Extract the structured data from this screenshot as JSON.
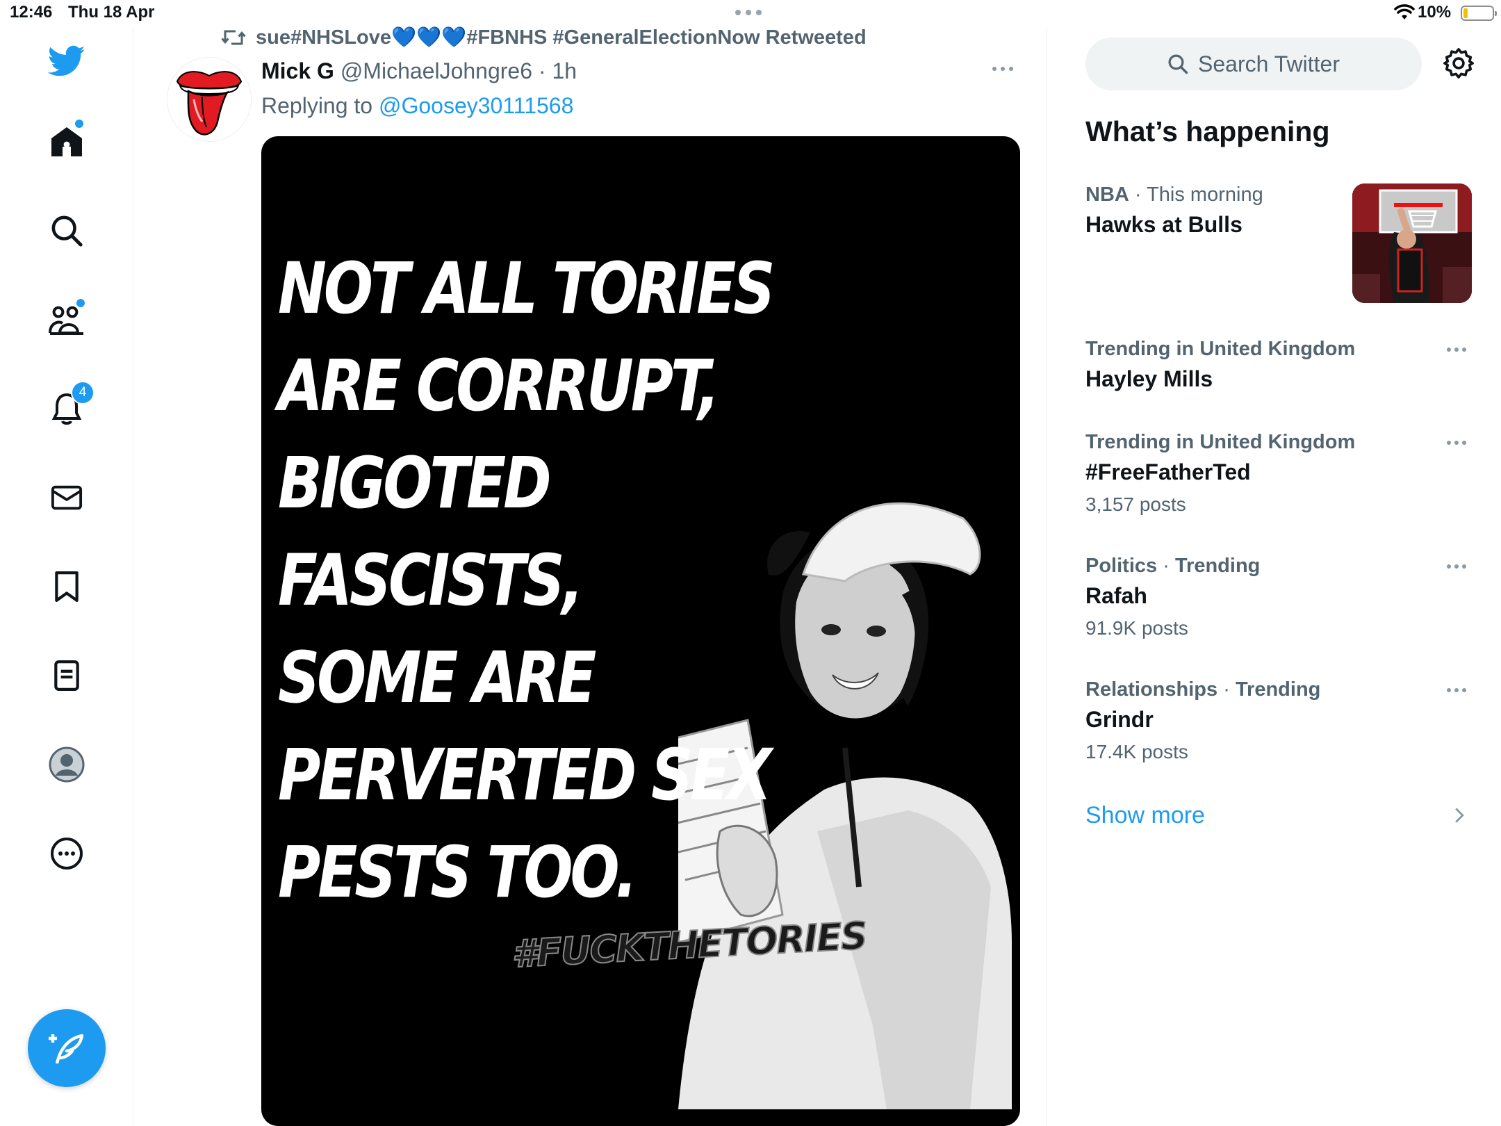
{
  "status_bar": {
    "time": "12:46",
    "date": "Thu 18 Apr",
    "battery": "10%"
  },
  "nav": {
    "items": [
      {
        "name": "home",
        "has_dot": true
      },
      {
        "name": "explore"
      },
      {
        "name": "communities",
        "has_dot": true
      },
      {
        "name": "notifications",
        "badge": "4"
      },
      {
        "name": "messages"
      },
      {
        "name": "bookmarks"
      },
      {
        "name": "lists"
      },
      {
        "name": "profile"
      },
      {
        "name": "more"
      }
    ]
  },
  "tweet": {
    "retweeted_by": "sue#NHSLove💙💙💙#FBNHS #GeneralElectionNow Retweeted",
    "author_name": "Mick G",
    "author_handle": "@MichaelJohngre6",
    "separator": "·",
    "time": "1h",
    "replying_prefix": "Replying to",
    "replying_handle": "@Goosey30111568",
    "media_text_lines": [
      "NOT ALL TORIES",
      "ARE CORRUPT,",
      "BIGOTED",
      "FASCISTS,",
      "SOME ARE",
      "PERVERTED SEX",
      "PESTS TOO."
    ],
    "media_hashtag": "#FUCKTHETORIES"
  },
  "sidebar": {
    "search_placeholder": "Search Twitter",
    "section_title": "What’s happening",
    "trends": [
      {
        "category": "NBA",
        "context": "This morning",
        "name": "Hawks at Bulls",
        "count": ""
      },
      {
        "category": "Trending in United Kingdom",
        "context": "",
        "name": "Hayley Mills",
        "count": ""
      },
      {
        "category": "Trending in United Kingdom",
        "context": "",
        "name": "#FreeFatherTed",
        "count": "3,157 posts"
      },
      {
        "category": "Politics",
        "context": "Trending",
        "name": "Rafah",
        "count": "91.9K posts"
      },
      {
        "category": "Relationships",
        "context": "Trending",
        "name": "Grindr",
        "count": "17.4K posts"
      }
    ],
    "show_more": "Show more"
  },
  "colors": {
    "accent": "#1d9bf0",
    "text_primary": "#0f1419",
    "text_secondary": "#536471"
  }
}
